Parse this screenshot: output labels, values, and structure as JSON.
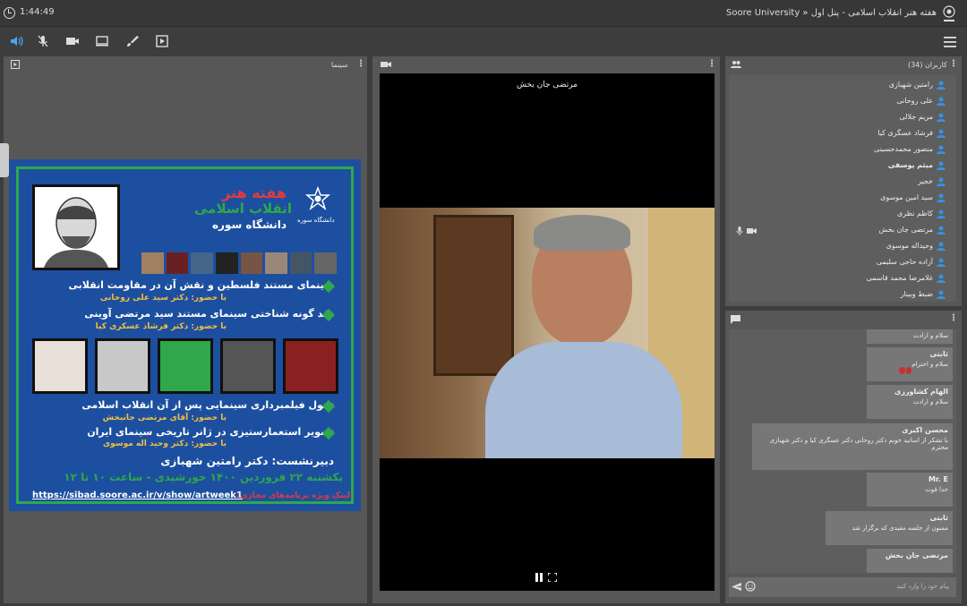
{
  "header": {
    "timer": "1:44:49",
    "title": "Soore University » هفته هنر انقلاب اسلامی - پنل اول"
  },
  "toolbar": {
    "icons": [
      "speaker-icon",
      "mic-off-icon",
      "camera-icon",
      "screen-share-icon",
      "brush-icon",
      "present-icon"
    ]
  },
  "left_panel": {
    "title": "سینما"
  },
  "poster": {
    "banner_title": "هفته هنر",
    "banner_sub": "انقلاب اسلامی",
    "banner_uni": "دانشگاه سوره",
    "logo_text": "دانشگاه سوره",
    "item1_title": "سینمای مستند فلسطین و نقش آن در مقاومت انقلابی",
    "item1_with": "با حضور: دکتر سید علی روحانی",
    "item2_title": "نقد گونه شناختی سینمای مستند سید مرتضی آوینی",
    "item2_with": "با حضور: دکتر فرشاد عسکری کیا",
    "item3_title": "تحول فیلمبرداری سینمایی پس از آن انقلاب اسلامی",
    "item3_with": "با حضور: آقای مرتضی جانبخش",
    "item4_title": "تصویر استعمارستیزی در ژانر تاریخی سینمای ایران",
    "item4_with": "با حضور: دکتر وحید اله موسوی",
    "secretary": "دبیرنشست: دکتر رامتین شهبازی",
    "date": "یکشنبه ۲۲ فروردین ۱۴۰۰ خورشیدی - ساعت ۱۰ تا ۱۲",
    "link_label": "لینک ویژه برنامه‌های مجازی:",
    "link_url": "https://sibad.soore.ac.ir/v/show/artweek1"
  },
  "video": {
    "presenter": "مرتضی جان بخش"
  },
  "users": {
    "header": "کاربران (34)",
    "list": [
      {
        "name": "رامتین شهبازی",
        "bold": false
      },
      {
        "name": "علی روحانی",
        "bold": false
      },
      {
        "name": "مریم جلالی",
        "bold": false
      },
      {
        "name": "فرشاد عسگری کیا",
        "bold": false
      },
      {
        "name": "منصور محمدحسینی",
        "bold": false
      },
      {
        "name": "میثم یوسفی",
        "bold": true
      },
      {
        "name": "خجیر",
        "bold": false
      },
      {
        "name": "سید امین موسوی",
        "bold": false
      },
      {
        "name": "کاظم نظری",
        "bold": false
      },
      {
        "name": "مرتضی جان بخش",
        "bold": false
      },
      {
        "name": "وحیداله موسوی",
        "bold": false
      },
      {
        "name": "آزاده حاجی سلیمی",
        "bold": false
      },
      {
        "name": "غلامرضا محمد قاسمی",
        "bold": false
      },
      {
        "name": "ضبط وبینار",
        "bold": false
      }
    ]
  },
  "chat": {
    "messages": [
      {
        "name": "",
        "text": "سلام و ارادت"
      },
      {
        "name": "ثابتی",
        "text": "سلام و احترام"
      },
      {
        "name": "الهام کشاورزی",
        "text": "سلام و ارادت"
      },
      {
        "name": "محسن اکبری",
        "text": "با تشکر از اساتید خوبم دکتر روحانی دکتر عسگری کیا و دکتر شهبازی محترم"
      },
      {
        "name": "Mr. E",
        "text": "خدا قوت"
      },
      {
        "name": "ثابتی",
        "text": "ممنون از جلسه مفیدی که برگزار شد"
      },
      {
        "name": "مرتضی جان بخش",
        "text": ""
      }
    ],
    "placeholder": "پیام خود را وارد کنید"
  },
  "colors": {
    "poster_bg": "#1d4fa0",
    "poster_accent": "#2ea84a",
    "user_icon": "#3b8fe6"
  }
}
